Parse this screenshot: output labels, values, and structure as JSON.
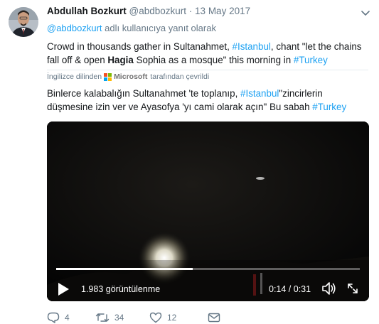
{
  "tweet": {
    "author_name": "Abdullah Bozkurt",
    "handle": "@abdbozkurt",
    "separator": "·",
    "date": "13 May 2017",
    "reply_mention": "@abdbozkurt",
    "reply_suffix": " adlı kullanıcıya yanıt olarak",
    "text": {
      "p1": "Crowd in thousands gather in Sultanahmet, ",
      "tag1": "#Istanbul",
      "p2": ", chant \"let the chains fall off & open ",
      "bold": "Hagia",
      "p3": " Sophia as a mosque\" this morning in ",
      "tag2": "#Turkey"
    },
    "translation": {
      "prefix": "İngilizce dilinden",
      "provider": "Microsoft",
      "suffix": "tarafından çevrildi",
      "logo_colors": [
        "#f25022",
        "#7fba00",
        "#00a4ef",
        "#ffb900"
      ]
    },
    "translated_text": {
      "p1": "Binlerce kalabalığın Sultanahmet 'te toplanıp, ",
      "tag1": "#Istanbul",
      "p2": "\"zincirlerin düşmesine izin ver ve Ayasofya 'yı cami olarak açın\" Bu sabah ",
      "tag2": "#Turkey"
    }
  },
  "video": {
    "views": "1.983 görüntülenme",
    "time": "0:14 / 0:31",
    "progress": 0.45
  },
  "actions": {
    "reply_count": "4",
    "retweet_count": "34",
    "like_count": "12"
  },
  "colors": {
    "link": "#1da1f2",
    "secondary_text": "#657786",
    "text": "#14171a"
  },
  "icons": [
    "chevron-down-icon",
    "play-icon",
    "volume-icon",
    "fullscreen-icon",
    "reply-icon",
    "retweet-icon",
    "like-icon",
    "message-icon"
  ]
}
